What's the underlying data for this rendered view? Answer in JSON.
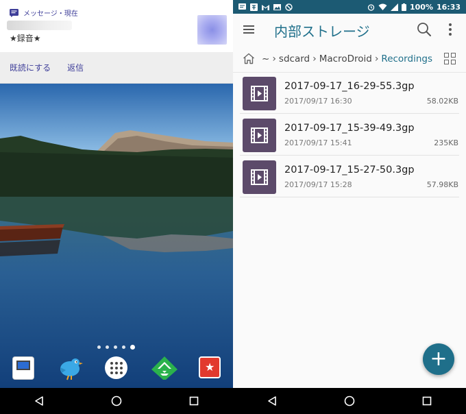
{
  "left": {
    "notification": {
      "app_name": "メッセージ・現在",
      "body": "★録音★"
    },
    "actions": [
      "既読にする",
      "返信"
    ],
    "home_icons": [
      "yahoo-icon",
      "twitter-bird-icon",
      "app-drawer-icon",
      "feedly-icon",
      "pocket-bookmark-icon"
    ]
  },
  "right": {
    "status_bar": {
      "battery": "100%",
      "time": "16:33"
    },
    "app_title": "内部ストレージ",
    "breadcrumb": {
      "root_symbol": "~",
      "items": [
        "sdcard",
        "MacroDroid",
        "Recordings"
      ]
    },
    "files": [
      {
        "name": "2017-09-17_16-29-55.3gp",
        "date": "2017/09/17 16:30",
        "size": "58.02KB"
      },
      {
        "name": "2017-09-17_15-39-49.3gp",
        "date": "2017/09/17 15:41",
        "size": "235KB"
      },
      {
        "name": "2017-09-17_15-27-50.3gp",
        "date": "2017/09/17 15:28",
        "size": "57.98KB"
      }
    ],
    "fab_label": "+"
  },
  "colors": {
    "accent": "#1f6f8a",
    "status_bar": "#1c5a73",
    "file_thumb": "#5c4a6a",
    "link": "#3e3e99"
  }
}
